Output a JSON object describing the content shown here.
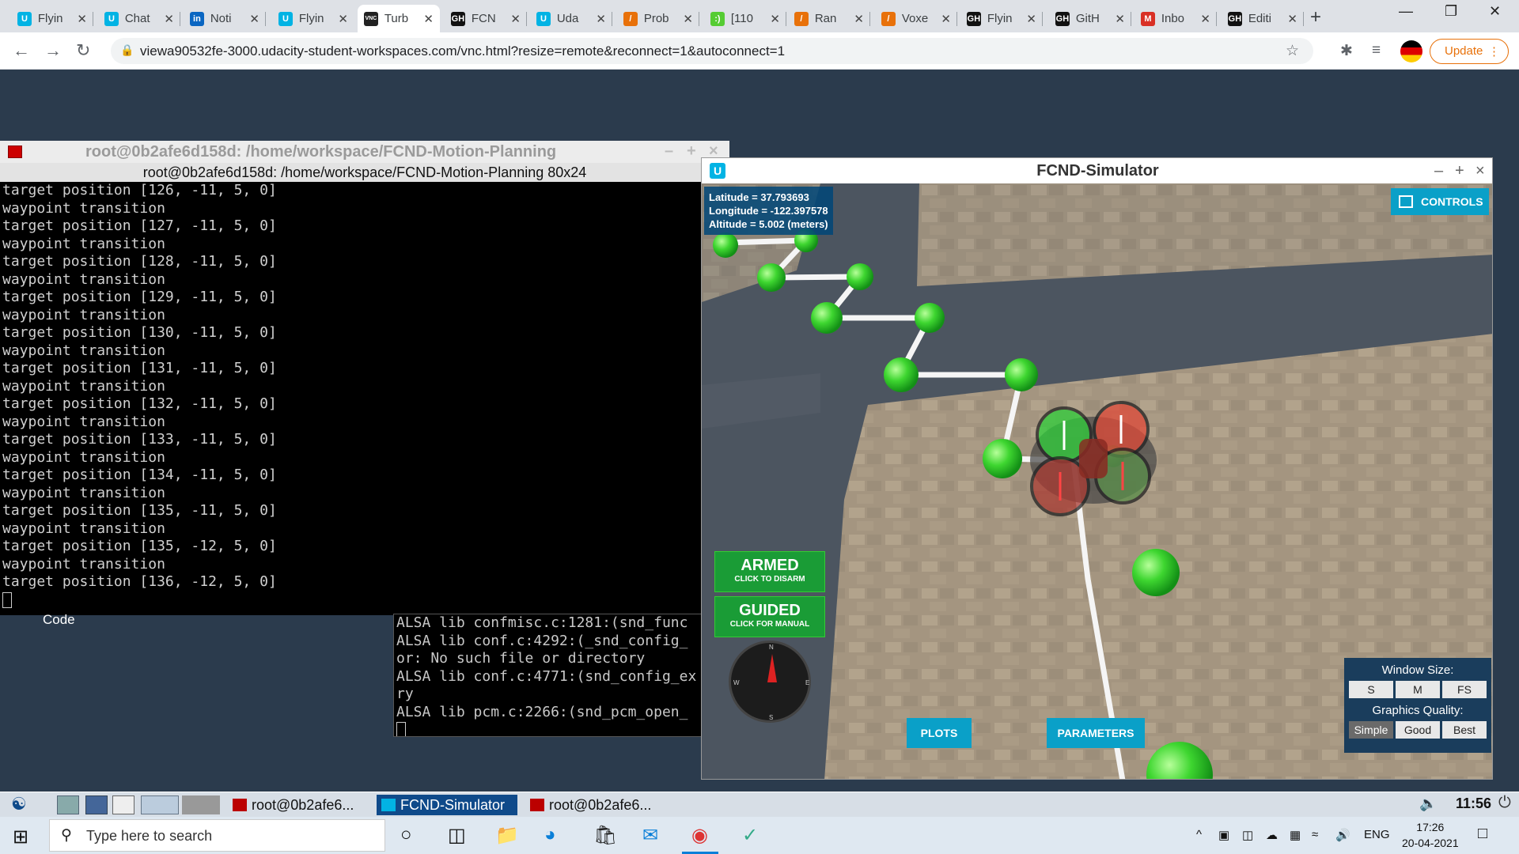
{
  "browser": {
    "tabs": [
      {
        "label": "Flyin",
        "color": "#02b3e4",
        "glyph": "U"
      },
      {
        "label": "Chat",
        "color": "#02b3e4",
        "glyph": "U"
      },
      {
        "label": "Noti",
        "color": "#0a66c2",
        "glyph": "in"
      },
      {
        "label": "Flyin",
        "color": "#02b3e4",
        "glyph": "U"
      },
      {
        "label": "Turb",
        "color": "#222",
        "glyph": "VNC"
      },
      {
        "label": "FCN",
        "color": "#111",
        "glyph": "GH"
      },
      {
        "label": "Uda",
        "color": "#02b3e4",
        "glyph": "U"
      },
      {
        "label": "Prob",
        "color": "#e8710a",
        "glyph": "/"
      },
      {
        "label": "[110",
        "color": "#5c3",
        "glyph": ":)"
      },
      {
        "label": "Ran",
        "color": "#e8710a",
        "glyph": "/"
      },
      {
        "label": "Voxe",
        "color": "#e8710a",
        "glyph": "/"
      },
      {
        "label": "Flyin",
        "color": "#111",
        "glyph": "GH"
      },
      {
        "label": "GitH",
        "color": "#111",
        "glyph": "GH"
      },
      {
        "label": "Inbo",
        "color": "#d93025",
        "glyph": "M"
      },
      {
        "label": "Editi",
        "color": "#111",
        "glyph": "GH"
      }
    ],
    "url": "viewa90532fe-3000.udacity-student-workspaces.com/vnc.html?resize=remote&reconnect=1&autoconnect=1",
    "update_label": "Update"
  },
  "terminal": {
    "title": "root@0b2afe6d158d: /home/workspace/FCND-Motion-Planning",
    "subtitle": "root@0b2afe6d158d: /home/workspace/FCND-Motion-Planning 80x24",
    "lines": [
      "target position [126, -11, 5, 0]",
      "waypoint transition",
      "target position [127, -11, 5, 0]",
      "waypoint transition",
      "target position [128, -11, 5, 0]",
      "waypoint transition",
      "target position [129, -11, 5, 0]",
      "waypoint transition",
      "target position [130, -11, 5, 0]",
      "waypoint transition",
      "target position [131, -11, 5, 0]",
      "waypoint transition",
      "target position [132, -11, 5, 0]",
      "waypoint transition",
      "target position [133, -11, 5, 0]",
      "waypoint transition",
      "target position [134, -11, 5, 0]",
      "waypoint transition",
      "target position [135, -11, 5, 0]",
      "waypoint transition",
      "target position [135, -12, 5, 0]",
      "waypoint transition",
      "target position [136, -12, 5, 0]"
    ]
  },
  "desktop": {
    "code_label": "Code"
  },
  "terminal2": {
    "lines": [
      "ALSA lib confmisc.c:1281:(snd_func",
      "ALSA lib conf.c:4292:(_snd_config_",
      "or: No such file or directory",
      "ALSA lib conf.c:4771:(snd_config_ex",
      "ry",
      "ALSA lib pcm.c:2266:(snd_pcm_open_"
    ]
  },
  "simulator": {
    "title": "FCND-Simulator",
    "latitude": "Latitude = 37.793693",
    "longitude": "Longitude = -122.397578",
    "altitude": "Altitude = 5.002 (meters)",
    "controls_label": "CONTROLS",
    "armed": {
      "main": "ARMED",
      "sub": "CLICK TO DISARM"
    },
    "guided": {
      "main": "GUIDED",
      "sub": "CLICK FOR MANUAL"
    },
    "compass": {
      "n": "N",
      "s": "S",
      "w": "W",
      "e": "E"
    },
    "plots_label": "PLOTS",
    "parameters_label": "PARAMETERS",
    "window_size_label": "Window Size:",
    "window_sizes": [
      "S",
      "M",
      "FS"
    ],
    "graphics_label": "Graphics Quality:",
    "graphics_options": [
      "Simple",
      "Good",
      "Best"
    ],
    "graphics_selected": "Simple"
  },
  "vnc_taskbar": {
    "items": [
      "root@0b2afe6...",
      "FCND-Simulator",
      "root@0b2afe6..."
    ],
    "clock": "11:56"
  },
  "windows_taskbar": {
    "search_placeholder": "Type here to search",
    "language": "ENG",
    "time": "17:26",
    "date": "20-04-2021"
  }
}
